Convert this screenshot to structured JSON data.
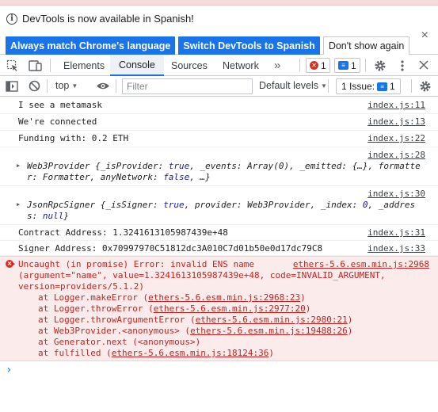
{
  "infobar": {
    "message": "DevTools is now available in Spanish!",
    "btn_match": "Always match Chrome's language",
    "btn_switch": "Switch DevTools to Spanish",
    "btn_dismiss": "Don't show again",
    "close": "×"
  },
  "tabs": {
    "elements": "Elements",
    "console": "Console",
    "sources": "Sources",
    "network": "Network",
    "more": "»",
    "error_count": "1",
    "message_count": "1"
  },
  "filterbar": {
    "context": "top",
    "filter_placeholder": "Filter",
    "levels": "Default levels",
    "issues_label": "1 Issue:",
    "issues_count": "1"
  },
  "console": {
    "lines": [
      {
        "text": "I see a metamask",
        "source": "index.js:11"
      },
      {
        "text": "We're connected",
        "source": "index.js:13"
      },
      {
        "text": "Funding with: 0.2 ETH",
        "source": "index.js:22"
      },
      {
        "text_a": "Web3Provider {_isProvider: ",
        "text_b": "true",
        "text_c": ", _events: Array(0), _emitted: {…}, formatte",
        "text_d": "r: Formatter, anyNetwork: ",
        "text_e": "false",
        "text_f": ", …}",
        "source": "index.js:28"
      },
      {
        "text_a": "JsonRpcSigner {_isSigner: ",
        "text_b": "true",
        "text_c": ", provider: Web3Provider, _index: ",
        "text_d": "0",
        "text_e": ", _addres",
        "text_f": "s: ",
        "text_g": "null",
        "text_h": "}",
        "source": "index.js:30"
      },
      {
        "text": "Contract Address: 1.3241613105987439e+48",
        "source": "index.js:31"
      },
      {
        "text": "Signer Address: 0x70997970C51812dc3A010C7d01b50e0d17dc79C8",
        "source": "index.js:33"
      }
    ],
    "error": {
      "line1": "Uncaught (in promise) Error: invalid ENS name",
      "source": "ethers-5.6.esm.min.js:2968",
      "line2": "(argument=\"name\", value=1.3241613105987439e+48, code=INVALID_ARGUMENT,",
      "line3": "version=providers/5.1.2)",
      "stack": [
        {
          "fn": "at Logger.makeError (",
          "loc": "ethers-5.6.esm.min.js:2968:23",
          "end": ")"
        },
        {
          "fn": "at Logger.throwError (",
          "loc": "ethers-5.6.esm.min.js:2977:20",
          "end": ")"
        },
        {
          "fn": "at Logger.throwArgumentError (",
          "loc": "ethers-5.6.esm.min.js:2980:21",
          "end": ")"
        },
        {
          "fn": "at Web3Provider.<anonymous> (",
          "loc": "ethers-5.6.esm.min.js:19488:26",
          "end": ")"
        },
        {
          "fn": "at Generator.next (<anonymous>)",
          "loc": "",
          "end": ""
        },
        {
          "fn": "at fulfilled (",
          "loc": "ethers-5.6.esm.min.js:18124:36",
          "end": ")"
        }
      ]
    },
    "prompt": "›"
  }
}
